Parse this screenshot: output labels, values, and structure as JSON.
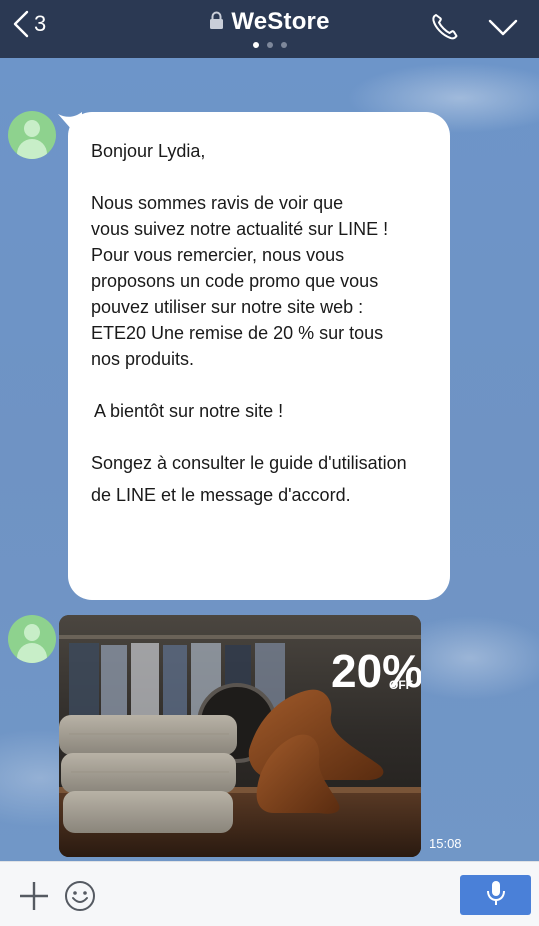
{
  "header": {
    "back_count": "3",
    "title": "WeStore",
    "page_dots": 3,
    "active_dot": 1,
    "icons": [
      "chevron-left-icon",
      "lock-icon",
      "phone-icon",
      "chevron-down-icon"
    ]
  },
  "messages": {
    "text_message": {
      "lines": [
        "Bonjour Lydia,",
        "Nous sommes ravis de voir que",
        "vous suivez notre actualité sur LINE !",
        "Pour vous remercier, nous vous",
        "proposons un code promo que vous",
        "pouvez utiliser sur notre site web :",
        "ETE20 Une remise de 20 % sur tous",
        "nos produits.",
        "A bientôt sur notre site !",
        "Songez à consulter le guide d'utilisation",
        "de LINE et le message d'accord."
      ]
    },
    "image_message": {
      "badge_value": "20%",
      "badge_suffix": "OFF",
      "time": "15:08"
    }
  },
  "footer": {
    "input_placeholder": "",
    "icons": [
      "plus-icon",
      "smiley-icon",
      "microphone-icon"
    ]
  },
  "colors": {
    "header_bg": "#2b3953",
    "chat_bg": "#6d93c6",
    "bubble_bg": "#ffffff",
    "avatar_bg": "#8ed28e",
    "mic_button_bg": "#4a80d8"
  }
}
